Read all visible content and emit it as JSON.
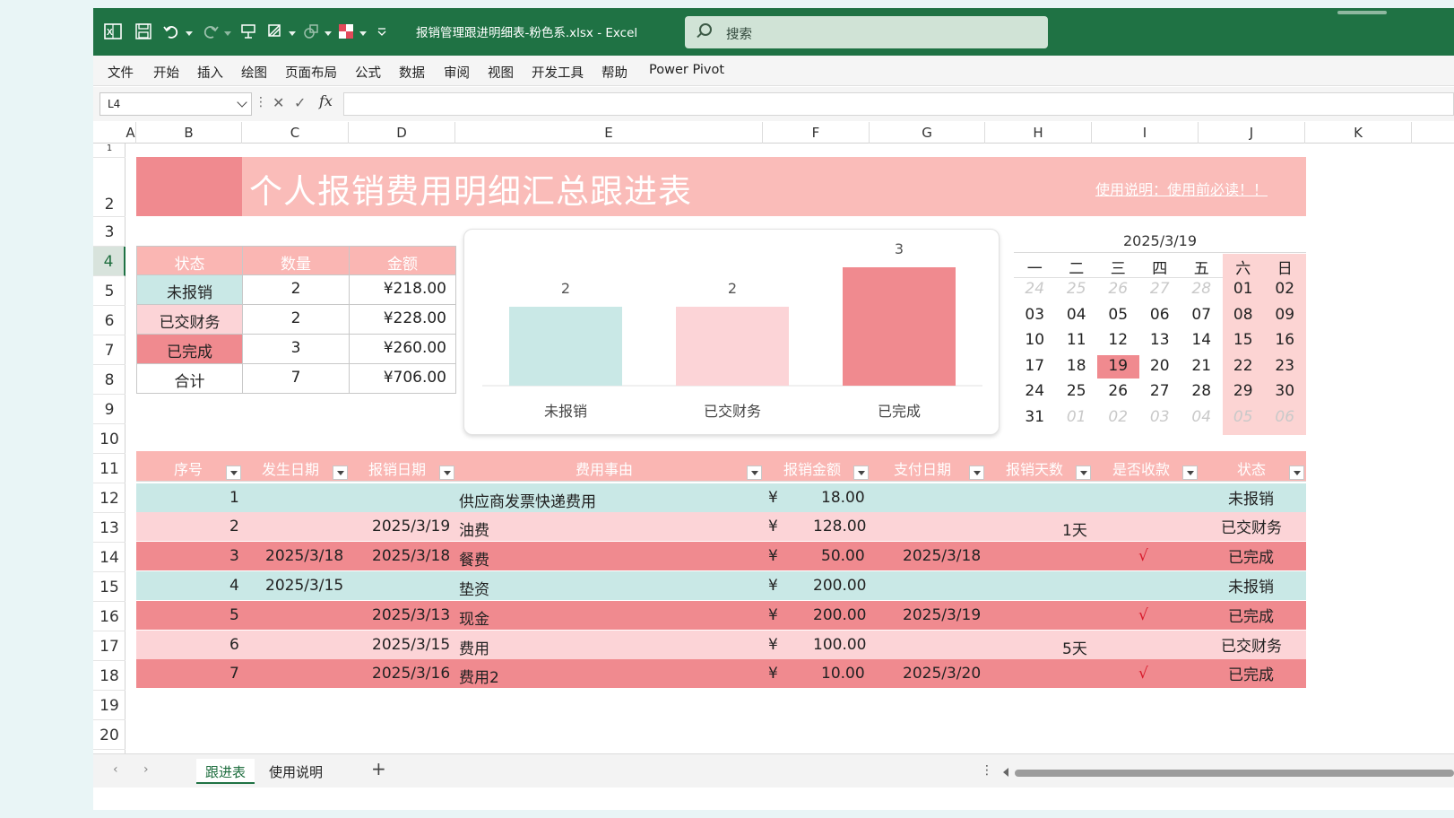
{
  "titlebar": {
    "doc_title": "报销管理跟进明细表-粉色系.xlsx  -  Excel",
    "search_placeholder": "搜索"
  },
  "menu": [
    "文件",
    "开始",
    "插入",
    "绘图",
    "页面布局",
    "公式",
    "数据",
    "审阅",
    "视图",
    "开发工具",
    "帮助",
    "Power Pivot"
  ],
  "formula_bar": {
    "name_box": "L4",
    "fx": "fx",
    "value": ""
  },
  "columns": [
    "A",
    "B",
    "C",
    "D",
    "E",
    "F",
    "G",
    "H",
    "I",
    "J",
    "K"
  ],
  "rows": [
    "1",
    "2",
    "3",
    "4",
    "5",
    "6",
    "7",
    "8",
    "9",
    "10",
    "11",
    "12",
    "13",
    "14",
    "15",
    "16",
    "17",
    "18",
    "19",
    "20"
  ],
  "selected_row": "4",
  "banner": {
    "title": "个人报销费用明细汇总跟进表",
    "link": "使用说明：使用前必读！！"
  },
  "summary": {
    "headers": [
      "状态",
      "数量",
      "金额"
    ],
    "rows": [
      {
        "status": "未报销",
        "count": "2",
        "amount": "¥218.00"
      },
      {
        "status": "已交财务",
        "count": "2",
        "amount": "¥228.00"
      },
      {
        "status": "已完成",
        "count": "3",
        "amount": "¥260.00"
      },
      {
        "status": "合计",
        "count": "7",
        "amount": "¥706.00"
      }
    ]
  },
  "chart_data": {
    "type": "bar",
    "categories": [
      "未报销",
      "已交财务",
      "已完成"
    ],
    "values": [
      2,
      2,
      3
    ],
    "colors": [
      "#c9e8e6",
      "#fcd4d7",
      "#f08a8f"
    ],
    "ylim": [
      0,
      3.5
    ],
    "data_labels": true,
    "grid": false
  },
  "calendar": {
    "title": "2025/3/19",
    "weekdays": [
      "一",
      "二",
      "三",
      "四",
      "五",
      "六",
      "日"
    ],
    "weeks": [
      [
        "24",
        "25",
        "26",
        "27",
        "28",
        "01",
        "02"
      ],
      [
        "03",
        "04",
        "05",
        "06",
        "07",
        "08",
        "09"
      ],
      [
        "10",
        "11",
        "12",
        "13",
        "14",
        "15",
        "16"
      ],
      [
        "17",
        "18",
        "19",
        "20",
        "21",
        "22",
        "23"
      ],
      [
        "24",
        "25",
        "26",
        "27",
        "28",
        "29",
        "30"
      ],
      [
        "31",
        "01",
        "02",
        "03",
        "04",
        "05",
        "06"
      ]
    ],
    "today": "19"
  },
  "table": {
    "headers": [
      "序号",
      "发生日期",
      "报销日期",
      "费用事由",
      "报销金额",
      "支付日期",
      "报销天数",
      "是否收款",
      "状态"
    ],
    "rows": [
      {
        "no": "1",
        "occur": "",
        "claim": "",
        "reason": "供应商发票快递费用",
        "currency": "¥",
        "amount": "18.00",
        "pay": "",
        "days": "",
        "received": "",
        "status": "未报销"
      },
      {
        "no": "2",
        "occur": "",
        "claim": "2025/3/19",
        "reason": "油费",
        "currency": "¥",
        "amount": "128.00",
        "pay": "",
        "days": "1天",
        "received": "",
        "status": "已交财务"
      },
      {
        "no": "3",
        "occur": "2025/3/18",
        "claim": "2025/3/18",
        "reason": "餐费",
        "currency": "¥",
        "amount": "50.00",
        "pay": "2025/3/18",
        "days": "",
        "received": "√",
        "status": "已完成"
      },
      {
        "no": "4",
        "occur": "2025/3/15",
        "claim": "",
        "reason": "垫资",
        "currency": "¥",
        "amount": "200.00",
        "pay": "",
        "days": "",
        "received": "",
        "status": "未报销"
      },
      {
        "no": "5",
        "occur": "",
        "claim": "2025/3/13",
        "reason": "现金",
        "currency": "¥",
        "amount": "200.00",
        "pay": "2025/3/19",
        "days": "",
        "received": "√",
        "status": "已完成"
      },
      {
        "no": "6",
        "occur": "",
        "claim": "2025/3/15",
        "reason": "费用",
        "currency": "¥",
        "amount": "100.00",
        "pay": "",
        "days": "5天",
        "received": "",
        "status": "已交财务"
      },
      {
        "no": "7",
        "occur": "",
        "claim": "2025/3/16",
        "reason": "费用2",
        "currency": "¥",
        "amount": "10.00",
        "pay": "2025/3/20",
        "days": "",
        "received": "√",
        "status": "已完成"
      }
    ]
  },
  "status_colors": {
    "未报销": "#c9e8e6",
    "已交财务": "#fcd4d7",
    "已完成": "#f08a8f",
    "合计": "#ffffff"
  },
  "sheets": {
    "tabs": [
      "跟进表",
      "使用说明"
    ],
    "active": "跟进表",
    "add": "+"
  },
  "colors": {
    "excel_green": "#1f7244",
    "header_pink": "#fab6b3",
    "banner_pink": "#fabcb9",
    "accent_pink": "#f08a8f",
    "mint": "#c9e8e6",
    "light_pink": "#fcd4d7"
  }
}
